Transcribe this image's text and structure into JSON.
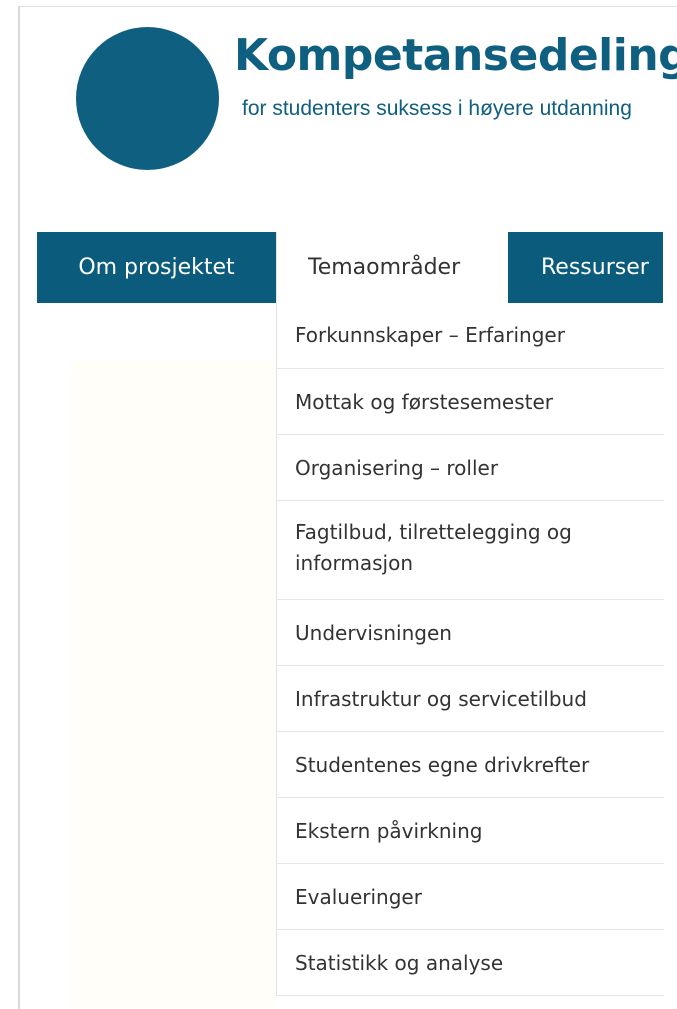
{
  "colors": {
    "brand": "#0f5f80",
    "brand_nav": "#0b5c7c",
    "text_dark": "#333333"
  },
  "header": {
    "logo_icon": "circle-logo",
    "title": "Kompetansedeling",
    "subtitle": "for studenters suksess i høyere utdanning"
  },
  "nav": {
    "tabs": [
      {
        "label": "Om prosjektet",
        "active": false
      },
      {
        "label": "Temaområder",
        "active": true
      },
      {
        "label": "Ressurser",
        "active": false
      }
    ]
  },
  "dropdown": {
    "items": [
      {
        "label": "Forkunnskaper – Erfaringer"
      },
      {
        "label": "Mottak og førstesemester"
      },
      {
        "label": "Organisering – roller"
      },
      {
        "label": "Fagtilbud, tilrettelegging og informasjon"
      },
      {
        "label": "Undervisningen"
      },
      {
        "label": "Infrastruktur og servicetilbud"
      },
      {
        "label": "Studentenes egne drivkrefter"
      },
      {
        "label": "Ekstern påvirkning"
      },
      {
        "label": "Evalueringer"
      },
      {
        "label": "Statistikk og analyse"
      }
    ]
  }
}
